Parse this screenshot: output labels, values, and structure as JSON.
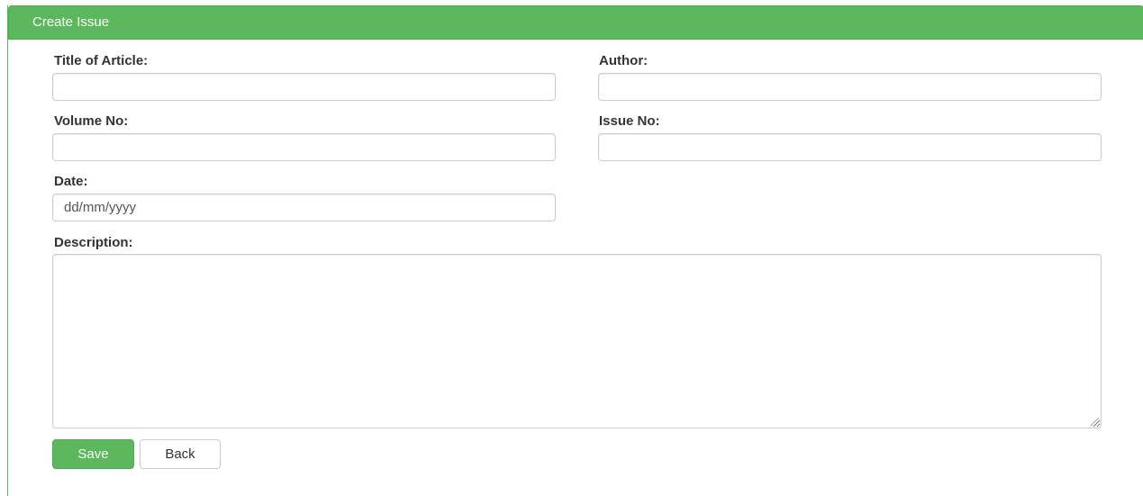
{
  "panel": {
    "title": "Create Issue"
  },
  "form": {
    "title_label": "Title of Article:",
    "title_value": "",
    "author_label": "Author:",
    "author_value": "",
    "volume_label": "Volume No:",
    "volume_value": "",
    "issue_label": "Issue No:",
    "issue_value": "",
    "date_label": "Date:",
    "date_placeholder": "dd/mm/yyyy",
    "description_label": "Description:",
    "description_value": ""
  },
  "actions": {
    "save_label": "Save",
    "back_label": "Back"
  },
  "colors": {
    "accent": "#5cb85c",
    "accent_border": "#4cae4c",
    "input_border": "#cccccc"
  }
}
